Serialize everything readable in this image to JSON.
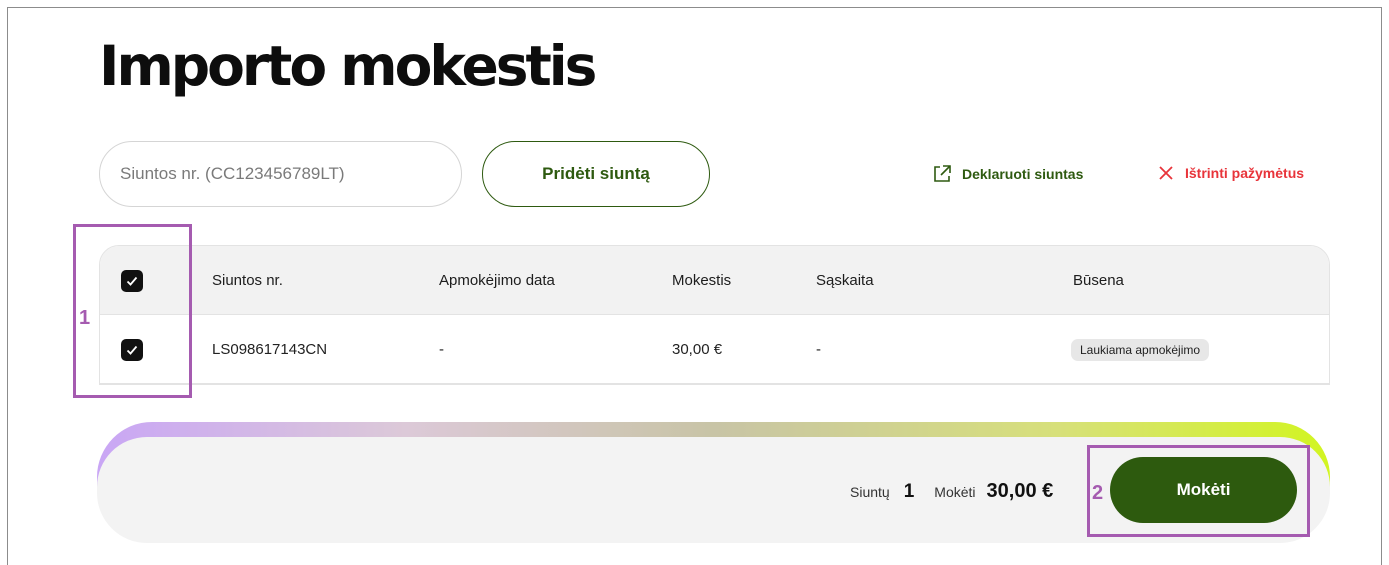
{
  "page": {
    "title": "Importo mokestis"
  },
  "toolbar": {
    "search_placeholder": "Siuntos nr. (CC123456789LT)",
    "add_button_label": "Pridėti siuntą",
    "declare_label": "Deklaruoti siuntas",
    "delete_label": "Ištrinti pažymėtus"
  },
  "table": {
    "columns": [
      "Siuntos nr.",
      "Apmokėjimo data",
      "Mokestis",
      "Sąskaita",
      "Būsena"
    ],
    "header_checked": true,
    "rows": [
      {
        "checked": true,
        "tracking_number": "LS098617143CN",
        "payment_date": "-",
        "fee": "30,00 €",
        "invoice": "-",
        "status": "Laukiama apmokėjimo"
      }
    ]
  },
  "footer": {
    "shipments_label": "Siuntų",
    "shipments_count": "1",
    "pay_label": "Mokėti",
    "total_amount": "30,00 €",
    "pay_button_label": "Mokėti"
  },
  "annotations": {
    "marker_1": "1",
    "marker_2": "2",
    "color": "#a55bb0"
  },
  "colors": {
    "brand_green": "#2d5a0e",
    "danger_red": "#e8343a"
  },
  "icons": {
    "declare": "external-link-icon",
    "delete": "close-icon",
    "checkbox": "checkmark-icon"
  }
}
